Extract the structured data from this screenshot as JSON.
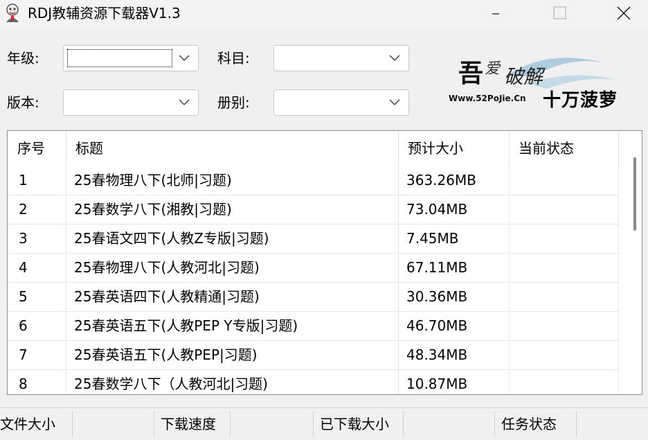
{
  "window": {
    "title": "RDJ教辅资源下载器V1.3",
    "controls": {
      "minimize": "minimize",
      "maximize": "maximize",
      "close": "close"
    }
  },
  "filters": {
    "grade_label": "年级:",
    "grade_value": "",
    "subject_label": "科目:",
    "subject_value": "",
    "edition_label": "版本:",
    "edition_value": "",
    "volume_label": "册别:",
    "volume_value": ""
  },
  "logo": {
    "image_text": "吾爱破解 Www.52PoJie.Cn",
    "caption": "十万菠萝"
  },
  "table": {
    "columns": [
      "序号",
      "标题",
      "预计大小",
      "当前状态"
    ],
    "rows": [
      {
        "index": "1",
        "title": "25春物理八下(北师|习题)",
        "size": "363.26MB",
        "status": ""
      },
      {
        "index": "2",
        "title": "25春数学八下(湘教|习题)",
        "size": "73.04MB",
        "status": ""
      },
      {
        "index": "3",
        "title": "25春语文四下(人教Z专版|习题)",
        "size": "7.45MB",
        "status": ""
      },
      {
        "index": "4",
        "title": "25春物理八下(人教河北|习题)",
        "size": "67.11MB",
        "status": ""
      },
      {
        "index": "5",
        "title": "25春英语四下(人教精通|习题)",
        "size": "30.36MB",
        "status": ""
      },
      {
        "index": "6",
        "title": "25春英语五下(人教PEP Y专版|习题)",
        "size": "46.70MB",
        "status": ""
      },
      {
        "index": "7",
        "title": "25春英语五下(人教PEP|习题)",
        "size": "48.34MB",
        "status": ""
      },
      {
        "index": "8",
        "title": "25春数学八下（人教河北|习题)",
        "size": "10.87MB",
        "status": ""
      }
    ]
  },
  "statusbar": {
    "file_size": "文件大小",
    "download_speed": "下载速度",
    "downloaded_size": "已下载大小",
    "task_status": "任务状态"
  },
  "colors": {
    "window_bg": "#f0f0f0",
    "table_bg": "#ffffff",
    "grid_line": "#e6e6e6",
    "scroll_thumb": "#8a8a8a"
  }
}
